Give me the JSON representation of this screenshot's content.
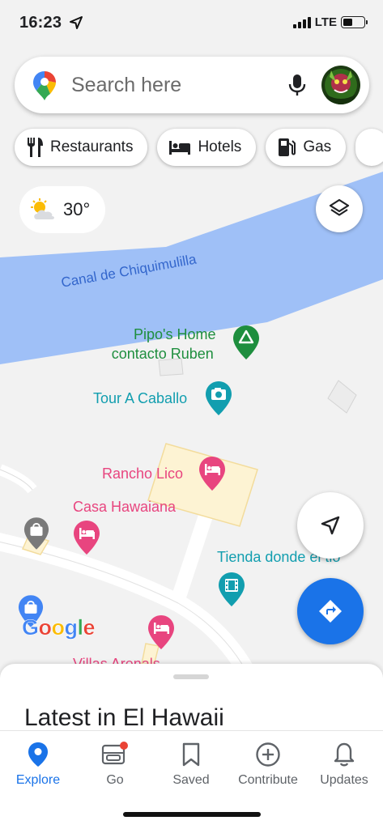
{
  "status": {
    "time": "16:23",
    "network": "LTE"
  },
  "search": {
    "placeholder": "Search here"
  },
  "chips": [
    {
      "label": "Restaurants",
      "icon": "fork-knife-icon"
    },
    {
      "label": "Hotels",
      "icon": "bed-icon"
    },
    {
      "label": "Gas",
      "icon": "gas-pump-icon"
    }
  ],
  "weather": {
    "temperature": "30°",
    "icon": "partly-cloudy-icon"
  },
  "map": {
    "labels": {
      "canal": "Canal de Chiquimulilla",
      "pipos_line1": "Pipo's Home",
      "pipos_line2": "contacto Ruben",
      "tour": "Tour A Caballo",
      "rancho": "Rancho Lico",
      "casa": "Casa Hawaiana",
      "tienda": "Tienda donde el tio",
      "villas": "Villas Arenals"
    },
    "colors": {
      "water": "#9fc0f7",
      "land": "#f2f2f2",
      "green_poi": "#1e8e3e",
      "teal_poi": "#129eaf",
      "pink_poi": "#e8457f"
    }
  },
  "attribution": {
    "text": "Google"
  },
  "sheet": {
    "title": "Latest in El Hawaii"
  },
  "nav": [
    {
      "label": "Explore",
      "icon": "map-pin-icon",
      "active": true
    },
    {
      "label": "Go",
      "icon": "car-icon",
      "active": false
    },
    {
      "label": "Saved",
      "icon": "bookmark-icon",
      "active": false
    },
    {
      "label": "Contribute",
      "icon": "plus-circle-icon",
      "active": false
    },
    {
      "label": "Updates",
      "icon": "bell-icon",
      "active": false
    }
  ]
}
